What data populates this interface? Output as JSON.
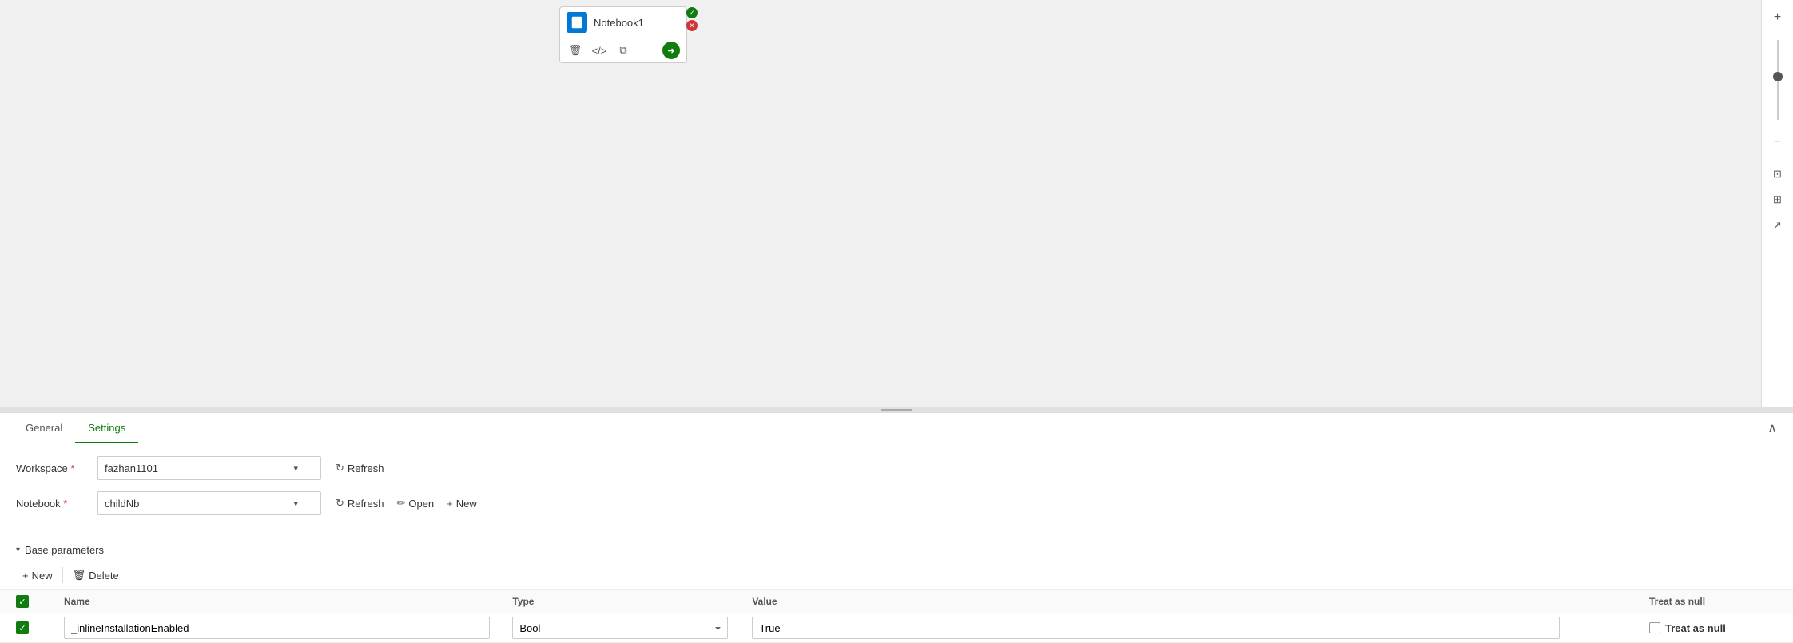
{
  "canvas": {
    "notebook_node": {
      "title": "Notebook1",
      "icon_char": "📓"
    }
  },
  "tabs": {
    "general_label": "General",
    "settings_label": "Settings"
  },
  "settings": {
    "workspace_label": "Workspace",
    "workspace_required": "*",
    "workspace_value": "fazhan1101",
    "notebook_label": "Notebook",
    "notebook_required": "*",
    "notebook_value": "childNb",
    "refresh_label": "Refresh",
    "open_label": "Open",
    "new_label": "New"
  },
  "base_parameters": {
    "section_label": "Base parameters",
    "new_btn_label": "New",
    "delete_btn_label": "Delete"
  },
  "table": {
    "col_name": "Name",
    "col_type": "Type",
    "col_value": "Value",
    "col_null": "Treat as null",
    "rows": [
      {
        "checked": true,
        "name": "_inlineInstallationEnabled",
        "type": "Bool",
        "value": "True",
        "treat_as_null": false
      }
    ]
  },
  "bottom_new": {
    "label": "New"
  },
  "zoom": {
    "plus_label": "+",
    "minus_label": "−"
  }
}
